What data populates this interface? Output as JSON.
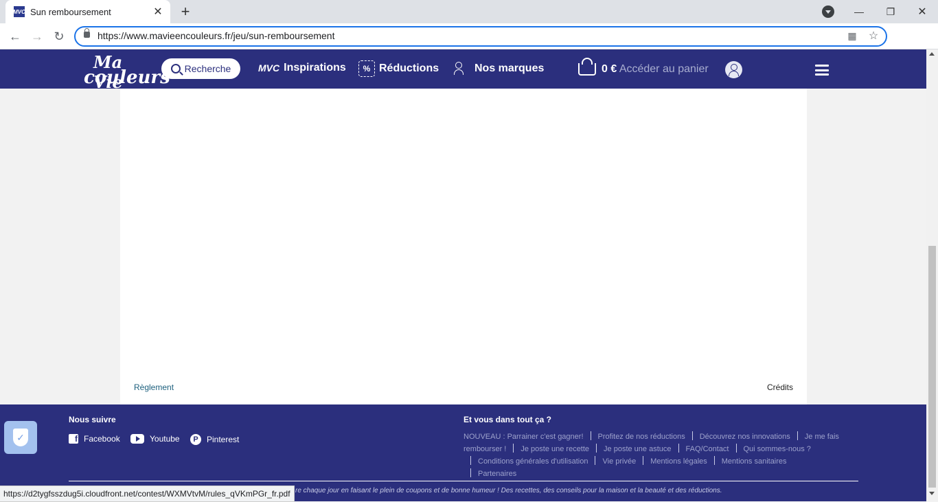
{
  "browser": {
    "tab_title": "Sun remboursement",
    "favicon_text": "MVC",
    "url": "https://www.mavieencouleurs.fr/jeu/sun-remboursement",
    "status_url": "https://d2tygfsszdug5i.cloudfront.net/contest/WXMVtvM/rules_qVKmPGr_fr.pdf"
  },
  "header": {
    "logo_line1": "Ma Vie",
    "logo_line2": "couleurs",
    "search_label": "Recherche",
    "inspirations_prefix": "MVC",
    "inspirations_label": "Inspirations",
    "reductions_label": "Réductions",
    "brands_label": "Nos marques",
    "cart_amount": "0 €",
    "cart_label": "Accéder au panier"
  },
  "content": {
    "reglement": "Règlement",
    "credits": "Crédits"
  },
  "footer": {
    "follow_title": "Nous suivre",
    "social": [
      "Facebook",
      "Youtube",
      "Pinterest"
    ],
    "links_title": "Et vous dans tout ça ?",
    "links": [
      "NOUVEAU : Parrainer c'est gagner!",
      "Profitez de nos réductions",
      "Découvrez nos innovations",
      "Je me fais rembourser !",
      "Je poste une recette",
      "Je poste une astuce",
      "FAQ/Contact",
      "Qui sommes-nous ?",
      "Conditions générales d'utilisation",
      "Vie privée",
      "Mentions légales",
      "Mentions sanitaires",
      "Partenaires"
    ],
    "tagline": "re chaque jour en faisant le plein de coupons et de bonne humeur ! Des recettes, des conseils pour la maison et la beauté et des réductions."
  },
  "colors": {
    "brand_navy": "#2b2f7d",
    "link_teal": "#1c5f7d",
    "footer_link": "#9da2cc"
  }
}
